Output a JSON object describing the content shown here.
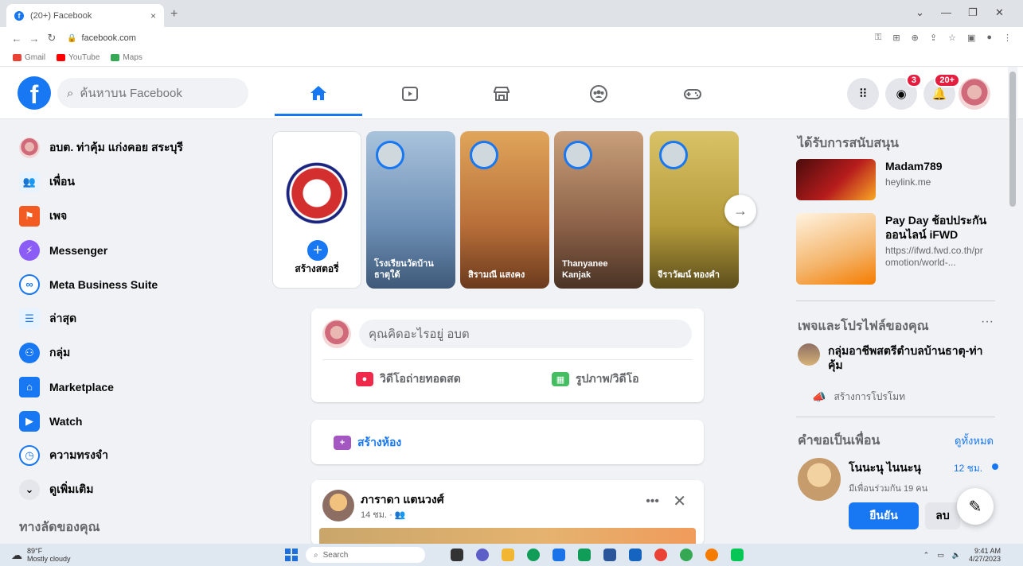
{
  "browser": {
    "tab_title": "(20+) Facebook",
    "tab_close": "×",
    "new_tab": "+",
    "url": "facebook.com",
    "bookmarks": [
      {
        "label": "Gmail",
        "color": "#ea4335"
      },
      {
        "label": "YouTube",
        "color": "#ff0000"
      },
      {
        "label": "Maps",
        "color": "#34a853"
      }
    ]
  },
  "header": {
    "logo": "f",
    "search_placeholder": "ค้นหาบน Facebook",
    "nav_tabs": [
      "home-icon",
      "watch-icon",
      "marketplace-icon",
      "groups-icon",
      "gaming-icon"
    ],
    "messenger_badge": "3",
    "notifications_badge": "20+"
  },
  "sidebar": {
    "items": [
      {
        "label": "อบต. ท่าคุ้ม แก่งคอย สระบุรี",
        "icon": "profile-avatar",
        "color": "#d06a7b"
      },
      {
        "label": "เพื่อน",
        "icon": "friends-icon",
        "color": "#1877f2"
      },
      {
        "label": "เพจ",
        "icon": "pages-icon",
        "color": "#f25c22"
      },
      {
        "label": "Messenger",
        "icon": "messenger-icon",
        "color": "#8b5cf6"
      },
      {
        "label": "Meta Business Suite",
        "icon": "meta-business-icon",
        "color": "#1877f2"
      },
      {
        "label": "ล่าสุด",
        "icon": "recent-icon",
        "color": "#1877f2"
      },
      {
        "label": "กลุ่ม",
        "icon": "groups-icon",
        "color": "#1877f2"
      },
      {
        "label": "Marketplace",
        "icon": "marketplace-icon",
        "color": "#1877f2"
      },
      {
        "label": "Watch",
        "icon": "watch-icon",
        "color": "#1877f2"
      },
      {
        "label": "ความทรงจำ",
        "icon": "memories-icon",
        "color": "#1877f2"
      },
      {
        "label": "ดูเพิ่มเติม",
        "icon": "chevron-down-icon",
        "color": "#e4e6eb"
      }
    ],
    "shortcuts_title": "ทางลัดของคุณ"
  },
  "stories": {
    "create_label": "สร้างสตอรี่",
    "items": [
      {
        "name": "โรงเรียนวัดบ้านธาตุใต้",
        "bg": "#8aa6c8"
      },
      {
        "name": "สิรามณี แสงคง",
        "bg": "#c7864e"
      },
      {
        "name": "Thanyanee Kanjak",
        "bg": "#b0866a"
      },
      {
        "name": "จีราวัฒน์ ทองคำ",
        "bg": "#c9b14f"
      }
    ]
  },
  "composer": {
    "prompt": "คุณคิดอะไรอยู่ อบต",
    "live_label": "วิดีโอถ่ายทอดสด",
    "photo_label": "รูปภาพ/วิดีโอ"
  },
  "room": {
    "label": "สร้างห้อง"
  },
  "post": {
    "author": "ภาราดา แตนวงศ์",
    "time": "14 ชม. · 👥"
  },
  "right": {
    "sponsored_title": "ได้รับการสนับสนุน",
    "ads": [
      {
        "title": "Madam789",
        "url": "heylink.me"
      },
      {
        "title": "Pay Day ช้อปประกันออนไลน์ iFWD",
        "url": "https://ifwd.fwd.co.th/promotion/world-..."
      }
    ],
    "pages_title": "เพจและโปรไฟล์ของคุณ",
    "page_name": "กลุ่มอาชีพสตรีตำบลบ้านธาตุ-ท่าคุ้ม",
    "promote_label": "สร้างการโปรโมท",
    "friend_req_title": "คำขอเป็นเพื่อน",
    "see_all": "ดูทั้งหมด",
    "friend_name": "โนนะนุ ไนนะนุ",
    "friend_time": "12 ชม.",
    "mutual": "มีเพื่อนร่วมกัน 19 คน",
    "confirm": "ยืนยัน",
    "delete": "ลบ"
  },
  "taskbar": {
    "temp": "89°F",
    "weather": "Mostly cloudy",
    "search": "Search",
    "time": "9:41 AM",
    "date": "4/27/2023"
  }
}
